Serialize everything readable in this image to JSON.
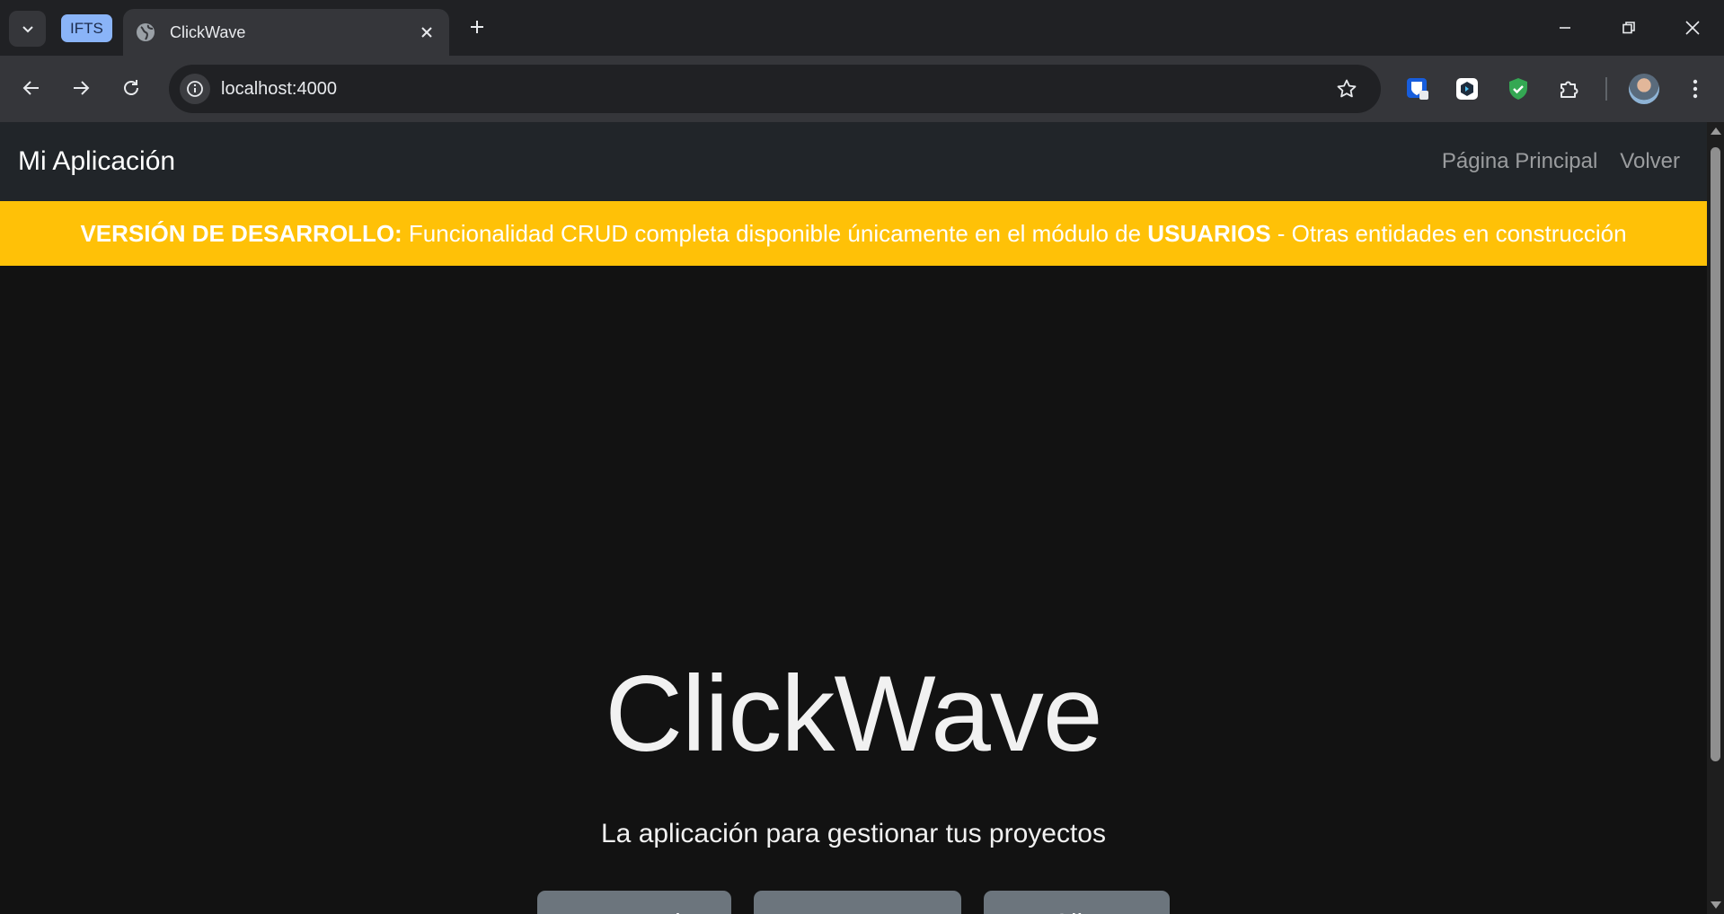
{
  "browser": {
    "tab_group_label": "IFTS",
    "tab_title": "ClickWave",
    "url": "localhost:4000"
  },
  "navbar": {
    "brand": "Mi Aplicación",
    "links": [
      "Página Principal",
      "Volver"
    ]
  },
  "banner": {
    "bold_prefix": "VERSIÓN DE DESARROLLO:",
    "text_middle": " Funcionalidad CRUD completa disponible únicamente en el módulo de ",
    "bold_module": "USUARIOS",
    "text_suffix": " - Otras entidades en construcción",
    "background": "#ffc107"
  },
  "hero": {
    "title": "ClickWave",
    "subtitle": "La aplicación para gestionar tus proyectos",
    "buttons": [
      "Ir a Usuarios",
      "Ir a Proyectos",
      "Ir a Clientes"
    ],
    "button_color": "#6c757d"
  },
  "icons": {
    "tab_search": "chevron-down-icon",
    "favicon": "globe-icon",
    "extensions": [
      "bitwarden-icon",
      "devtools-extension-icon",
      "shield-check-icon",
      "puzzle-icon"
    ]
  }
}
